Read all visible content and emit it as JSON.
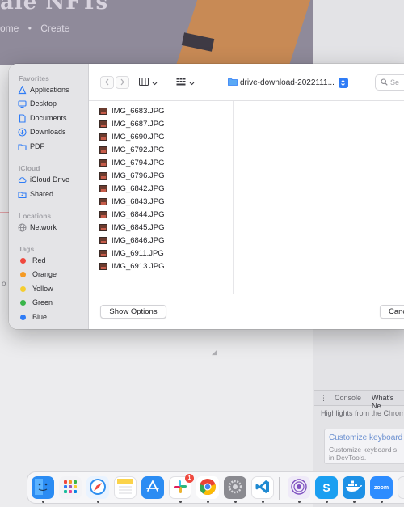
{
  "background": {
    "hero_title": "ale NFTs",
    "nav_home": "ome",
    "nav_create": "Create",
    "nav_dot": "•",
    "left_letter": "o",
    "devtools": {
      "tab_console": "Console",
      "tab_whats_new": "What's Ne",
      "highlights": "Highlights from the Chrom",
      "card_link": "Customize keyboard",
      "card_desc_1": "Customize keyboard s",
      "card_desc_2": "in DevTools."
    }
  },
  "dialog": {
    "sidebar": {
      "favorites_header": "Favorites",
      "favorites": [
        {
          "label": "Applications",
          "icon": "applications-icon"
        },
        {
          "label": "Desktop",
          "icon": "desktop-icon"
        },
        {
          "label": "Documents",
          "icon": "documents-icon"
        },
        {
          "label": "Downloads",
          "icon": "downloads-icon"
        },
        {
          "label": "PDF",
          "icon": "folder-icon"
        }
      ],
      "icloud_header": "iCloud",
      "icloud": [
        {
          "label": "iCloud Drive",
          "icon": "icloud-icon"
        },
        {
          "label": "Shared",
          "icon": "shared-folder-icon"
        }
      ],
      "locations_header": "Locations",
      "locations": [
        {
          "label": "Network",
          "icon": "network-icon"
        }
      ],
      "tags_header": "Tags",
      "tags": [
        {
          "label": "Red",
          "color": "#f0483e"
        },
        {
          "label": "Orange",
          "color": "#f59a23"
        },
        {
          "label": "Yellow",
          "color": "#f5cd2f"
        },
        {
          "label": "Green",
          "color": "#39b54a"
        },
        {
          "label": "Blue",
          "color": "#2f7cf6"
        }
      ]
    },
    "toolbar": {
      "folder_name": "drive-download-2022111...",
      "search_placeholder": "Se"
    },
    "files": [
      "IMG_6683.JPG",
      "IMG_6687.JPG",
      "IMG_6690.JPG",
      "IMG_6792.JPG",
      "IMG_6794.JPG",
      "IMG_6796.JPG",
      "IMG_6842.JPG",
      "IMG_6843.JPG",
      "IMG_6844.JPG",
      "IMG_6845.JPG",
      "IMG_6846.JPG",
      "IMG_6911.JPG",
      "IMG_6913.JPG"
    ],
    "footer": {
      "show_options": "Show Options",
      "cancel": "Canc"
    }
  },
  "dock": {
    "apps": [
      {
        "name": "finder",
        "label": "",
        "color": "#2b8cf3"
      },
      {
        "name": "launchpad",
        "label": "",
        "color": "#e9e9ee"
      },
      {
        "name": "safari",
        "label": "",
        "color": "#2e8ff0"
      },
      {
        "name": "notes",
        "label": "",
        "color": "#fbd34a"
      },
      {
        "name": "app-store",
        "label": "",
        "color": "#2b8cf3"
      },
      {
        "name": "slack",
        "label": "",
        "color": "#ffffff",
        "badge": "1"
      },
      {
        "name": "chrome",
        "label": "",
        "color": "#ffffff"
      },
      {
        "name": "system-preferences",
        "label": "",
        "color": "#8a8a90"
      },
      {
        "name": "vscode",
        "label": "",
        "color": "#1f8ad2"
      },
      {
        "name": "tor-browser",
        "label": "",
        "color": "#ece9f6"
      },
      {
        "name": "skype",
        "label": "S",
        "color": "#1a9ff1"
      },
      {
        "name": "docker",
        "label": "",
        "color": "#1d91e6"
      },
      {
        "name": "zoom",
        "label": "zoom",
        "color": "#2d8cff"
      },
      {
        "name": "partial-app",
        "label": "",
        "color": "#f2f2f4"
      }
    ]
  }
}
